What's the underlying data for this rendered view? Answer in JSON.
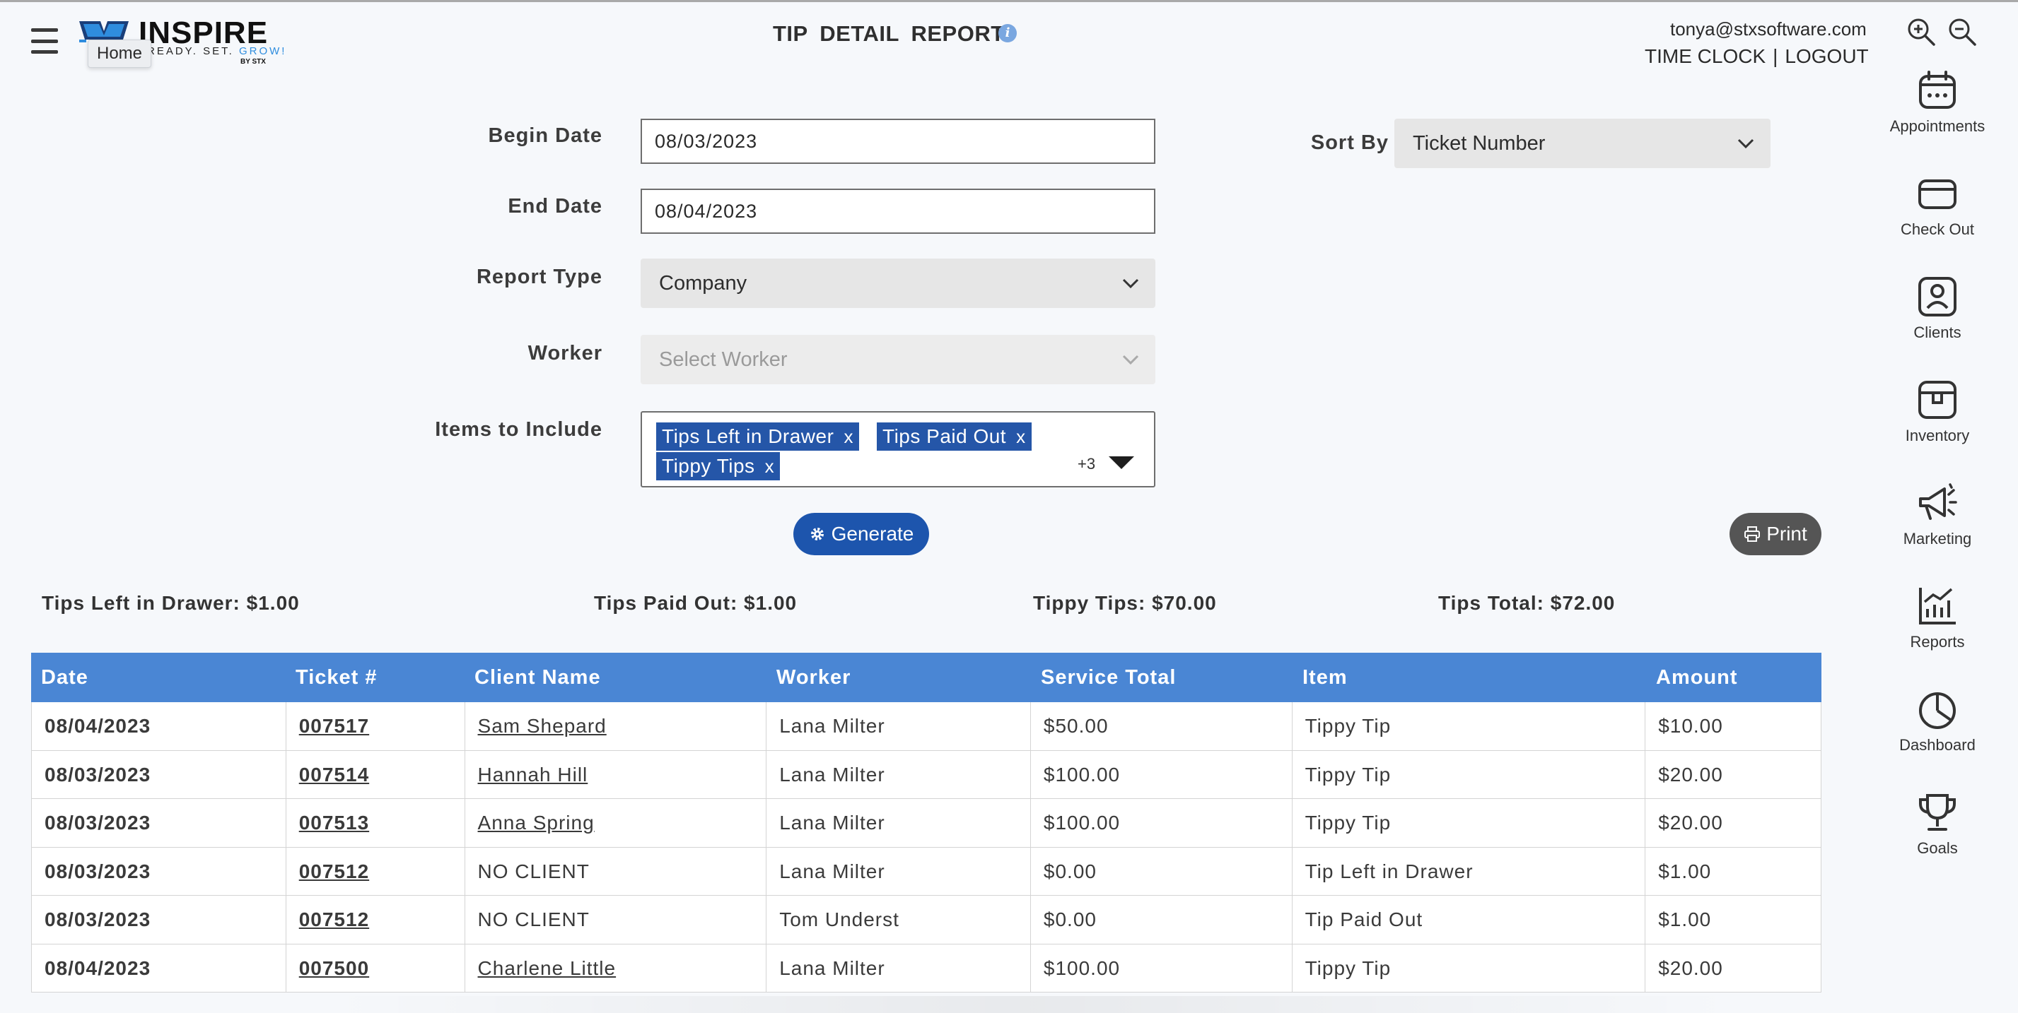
{
  "header": {
    "logo_word": "INSPIRE",
    "logo_tagline": "READY. SET. ",
    "logo_tagline_accent": "GROW!",
    "logo_by": "BY STX",
    "home_tooltip": "Home",
    "title": "TIP DETAIL REPORT",
    "user_email": "tonya@stxsoftware.com",
    "time_clock": "TIME CLOCK",
    "separator": "|",
    "logout": "LOGOUT"
  },
  "nav": {
    "items": [
      {
        "label": "Appointments",
        "icon": "calendar-icon"
      },
      {
        "label": "Check Out",
        "icon": "credit-card-icon"
      },
      {
        "label": "Clients",
        "icon": "person-icon"
      },
      {
        "label": "Inventory",
        "icon": "box-icon"
      },
      {
        "label": "Marketing",
        "icon": "megaphone-icon"
      },
      {
        "label": "Reports",
        "icon": "bar-chart-icon"
      },
      {
        "label": "Dashboard",
        "icon": "pie-chart-icon"
      },
      {
        "label": "Goals",
        "icon": "trophy-icon"
      }
    ]
  },
  "form": {
    "begin_date_label": "Begin Date",
    "begin_date_value": "08/03/2023",
    "end_date_label": "End Date",
    "end_date_value": "08/04/2023",
    "report_type_label": "Report Type",
    "report_type_value": "Company",
    "worker_label": "Worker",
    "worker_placeholder": "Select Worker",
    "items_label": "Items to Include",
    "items": [
      "Tips Left in Drawer",
      "Tips Paid Out",
      "Tippy Tips"
    ],
    "tag_remove": "x",
    "items_more": "+3",
    "sort_by_label": "Sort By",
    "sort_by_value": "Ticket Number",
    "generate_label": "Generate",
    "print_label": "Print"
  },
  "summary": {
    "tips_left_in_drawer": "Tips Left in Drawer: $1.00",
    "tips_paid_out": "Tips Paid Out: $1.00",
    "tippy_tips": "Tippy Tips: $70.00",
    "tips_total": "Tips Total: $72.00"
  },
  "table": {
    "columns": [
      "Date",
      "Ticket #",
      "Client Name",
      "Worker",
      "Service Total",
      "Item",
      "Amount"
    ],
    "rows": [
      [
        "08/04/2023",
        "007517",
        "Sam Shepard",
        "Lana Milter",
        "$50.00",
        "Tippy Tip",
        "$10.00"
      ],
      [
        "08/03/2023",
        "007514",
        "Hannah Hill",
        "Lana Milter",
        "$100.00",
        "Tippy Tip",
        "$20.00"
      ],
      [
        "08/03/2023",
        "007513",
        "Anna Spring",
        "Lana Milter",
        "$100.00",
        "Tippy Tip",
        "$20.00"
      ],
      [
        "08/03/2023",
        "007512",
        "NO CLIENT",
        "Lana Milter",
        "$0.00",
        "Tip Left in Drawer",
        "$1.00"
      ],
      [
        "08/03/2023",
        "007512",
        "NO CLIENT",
        "Tom Underst",
        "$0.00",
        "Tip Paid Out",
        "$1.00"
      ],
      [
        "08/04/2023",
        "007500",
        "Charlene Little",
        "Lana Milter",
        "$100.00",
        "Tippy Tip",
        "$20.00"
      ]
    ]
  },
  "colors": {
    "table_header": "#4a86d4",
    "tag_bg": "#2556a8",
    "generate_bg": "#1d55ad",
    "print_bg": "#555555",
    "info_icon": "#7aa7e0"
  }
}
